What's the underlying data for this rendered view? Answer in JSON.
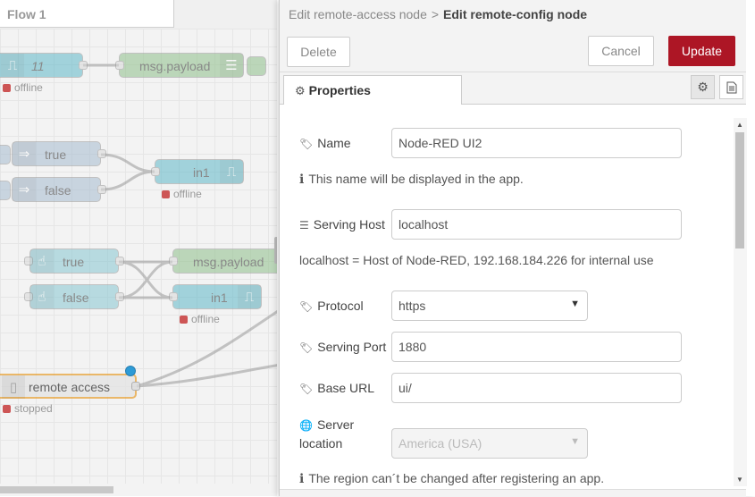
{
  "workspace": {
    "tab_label": "Flow 1",
    "nodes": [
      {
        "label": "11",
        "status": "offline"
      },
      {
        "label": "msg.payload"
      },
      {
        "label": "true"
      },
      {
        "label": "false"
      },
      {
        "label": "in1",
        "status": "offline"
      },
      {
        "label": "true"
      },
      {
        "label": "false"
      },
      {
        "label": "msg.payload"
      },
      {
        "label": "in1",
        "status": "offline"
      },
      {
        "label": "remote access",
        "status": "stopped"
      }
    ]
  },
  "tray": {
    "breadcrumb": {
      "parent": "Edit remote-access node",
      "separator": ">",
      "current": "Edit remote-config node"
    },
    "buttons": {
      "delete": "Delete",
      "cancel": "Cancel",
      "update": "Update"
    },
    "tabs": {
      "properties": "Properties"
    },
    "form": {
      "name": {
        "label": "Name",
        "value": "Node-RED UI2",
        "tip": "This name will be displayed in the app."
      },
      "host": {
        "label": "Serving Host",
        "value": "localhost",
        "tip": "localhost = Host of Node-RED, 192.168.184.226 for internal use"
      },
      "protocol": {
        "label": "Protocol",
        "value": "https"
      },
      "port": {
        "label": "Serving Port",
        "value": "1880"
      },
      "base_url": {
        "label": "Base URL",
        "value": "ui/"
      },
      "location": {
        "label_line1": "Server",
        "label_line2": "location",
        "value": "America (USA)",
        "tip": "The region can´t be changed after registering an app."
      }
    }
  },
  "colors": {
    "update_button": "#ad1625",
    "node_teal": "#5fb8c8",
    "node_green": "#8fc08a",
    "node_grey": "#a6bbcf",
    "node_light_teal": "#87c7d2",
    "status_red": "#c02020",
    "remote_access_orange": "#e8a33a"
  }
}
